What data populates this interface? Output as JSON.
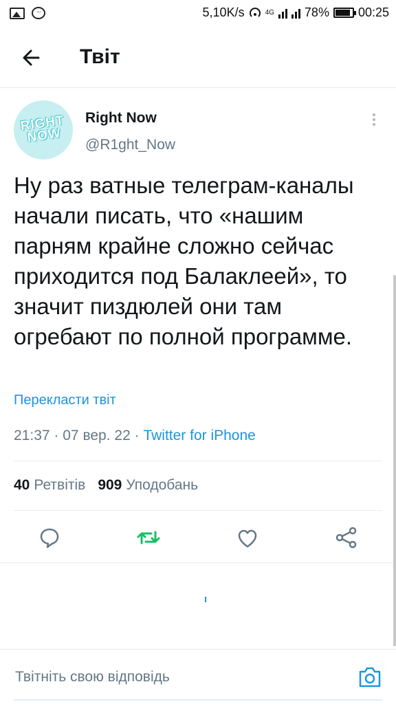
{
  "status_bar": {
    "speed": "5,10K/s",
    "network": "4G",
    "battery": "78%",
    "time": "00:25"
  },
  "header": {
    "title": "Твіт"
  },
  "tweet": {
    "author_name": "Right Now",
    "author_handle": "@R1ght_Now",
    "avatar_logo": [
      "RIGHT",
      "NOW"
    ],
    "text": "Ну раз ватные телеграм-каналы начали писать, что «нашим парням крайне сложно сейчас приходится под Балаклеей», то значит пиздюлей они там огребают по полной программе.",
    "translate_label": "Перекласти твіт",
    "time": "21:37",
    "date": "07 вер. 22",
    "source": "Twitter for iPhone",
    "separator": "·",
    "retweets_count": "40",
    "retweets_label": "Ретвітів",
    "likes_count": "909",
    "likes_label": "Уподобань"
  },
  "actions": {
    "reply_icon": "reply-icon",
    "retweet_icon": "retweet-icon",
    "like_icon": "heart-icon",
    "share_icon": "share-icon"
  },
  "reply_bar": {
    "placeholder": "Твітніть свою відповідь"
  },
  "colors": {
    "accent": "#1b95e0",
    "retweet": "#17bf63",
    "secondary_text": "#657786",
    "avatar_bg": "#c7eef0"
  }
}
